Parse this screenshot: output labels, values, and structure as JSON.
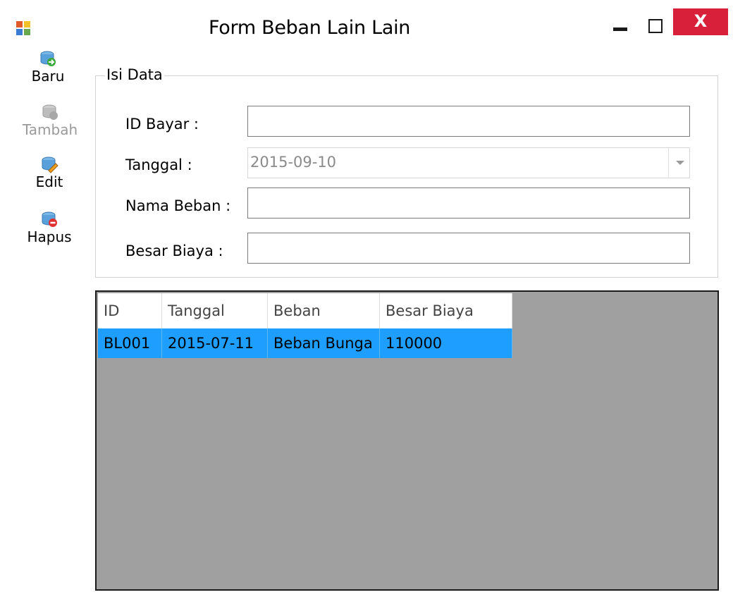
{
  "window": {
    "title": "Form Beban Lain Lain",
    "close_glyph": "X"
  },
  "toolbar": {
    "items": [
      {
        "label": "Baru",
        "icon": "add-record-icon",
        "enabled": true
      },
      {
        "label": "Tambah",
        "icon": "save-record-icon",
        "enabled": false
      },
      {
        "label": "Edit",
        "icon": "edit-record-icon",
        "enabled": true
      },
      {
        "label": "Hapus",
        "icon": "delete-record-icon",
        "enabled": true
      }
    ]
  },
  "form": {
    "group_title": "Isi Data",
    "fields": {
      "id_bayar": {
        "label": "ID Bayar :",
        "value": ""
      },
      "tanggal": {
        "label": "Tanggal :",
        "value": "2015-09-10"
      },
      "nama_beban": {
        "label": "Nama Beban :",
        "value": ""
      },
      "besar_biaya": {
        "label": "Besar Biaya :",
        "value": ""
      }
    }
  },
  "grid": {
    "columns": [
      "ID",
      "Tanggal",
      "Beban",
      "Besar Biaya"
    ],
    "rows": [
      [
        "BL001",
        "2015-07-11",
        "Beban Bunga",
        "110000"
      ]
    ],
    "selected_row_color": "#1e9eff",
    "background_color": "#a0a0a0"
  },
  "colors": {
    "close_button": "#d8203b"
  }
}
